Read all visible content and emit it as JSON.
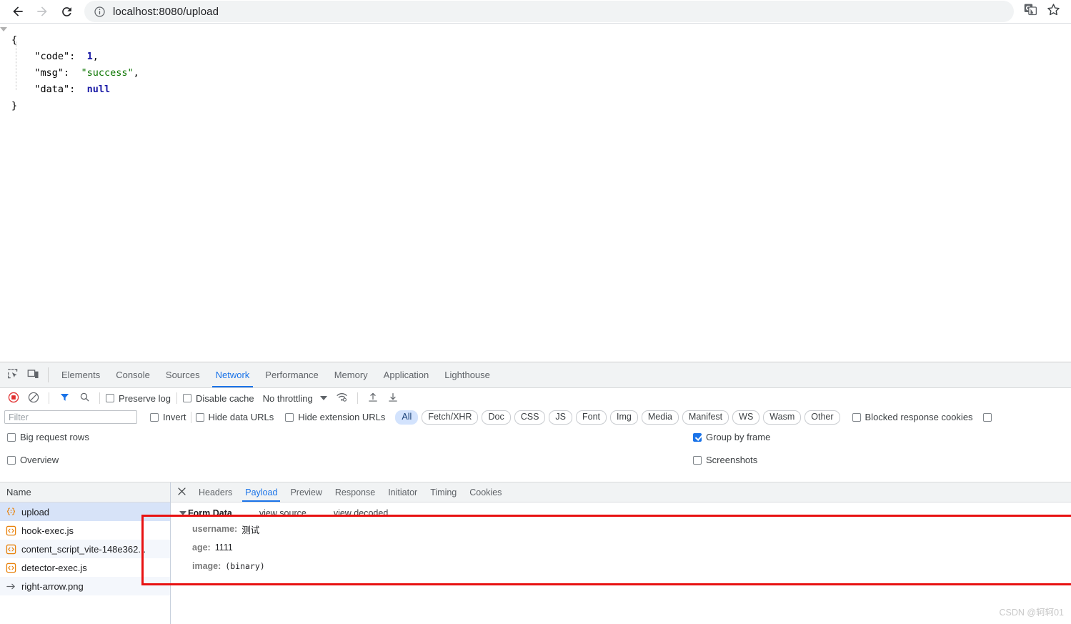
{
  "browser": {
    "back_icon": "arrow-left-icon",
    "forward_icon": "arrow-right-icon",
    "reload_icon": "reload-icon",
    "site_info_icon": "info-circle-icon",
    "url": "localhost:8080/upload",
    "translate_icon": "translate-icon",
    "bookmark_icon": "star-icon"
  },
  "page": {
    "json_response": {
      "open_brace": "{",
      "close_brace": "}",
      "entries": [
        {
          "key": "\"code\"",
          "colon": ":",
          "value": "1",
          "type": "number",
          "trail": ","
        },
        {
          "key": "\"msg\"",
          "colon": ":",
          "value": "\"success\"",
          "type": "string",
          "trail": ","
        },
        {
          "key": "\"data\"",
          "colon": ":",
          "value": "null",
          "type": "null",
          "trail": ""
        }
      ]
    }
  },
  "devtools": {
    "inspect_icon": "inspect-element-icon",
    "device_icon": "device-toolbar-icon",
    "tabs": [
      {
        "label": "Elements",
        "active": false
      },
      {
        "label": "Console",
        "active": false
      },
      {
        "label": "Sources",
        "active": false
      },
      {
        "label": "Network",
        "active": true
      },
      {
        "label": "Performance",
        "active": false
      },
      {
        "label": "Memory",
        "active": false
      },
      {
        "label": "Application",
        "active": false
      },
      {
        "label": "Lighthouse",
        "active": false
      }
    ],
    "network_controls": {
      "record_icon": "record-stop-icon",
      "clear_icon": "clear-icon",
      "filter_icon": "funnel-filter-icon",
      "search_icon": "search-icon",
      "preserve_log_label": "Preserve log",
      "preserve_log_checked": false,
      "disable_cache_label": "Disable cache",
      "disable_cache_checked": false,
      "throttling_label": "No throttling",
      "wifi_icon": "network-conditions-icon",
      "import_icon": "import-har-icon",
      "export_icon": "export-har-icon"
    },
    "filter_bar": {
      "filter_placeholder": "Filter",
      "filter_value": "",
      "invert_label": "Invert",
      "invert_checked": false,
      "hide_data_urls_label": "Hide data URLs",
      "hide_data_urls_checked": false,
      "hide_extension_urls_label": "Hide extension URLs",
      "hide_extension_urls_checked": false,
      "type_chips": [
        {
          "label": "All",
          "selected": true
        },
        {
          "label": "Fetch/XHR",
          "selected": false
        },
        {
          "label": "Doc",
          "selected": false
        },
        {
          "label": "CSS",
          "selected": false
        },
        {
          "label": "JS",
          "selected": false
        },
        {
          "label": "Font",
          "selected": false
        },
        {
          "label": "Img",
          "selected": false
        },
        {
          "label": "Media",
          "selected": false
        },
        {
          "label": "Manifest",
          "selected": false
        },
        {
          "label": "WS",
          "selected": false
        },
        {
          "label": "Wasm",
          "selected": false
        },
        {
          "label": "Other",
          "selected": false
        }
      ],
      "blocked_cookies_label": "Blocked response cookies",
      "blocked_cookies_checked": false,
      "extra_checkbox_checked": false
    },
    "options": {
      "big_request_rows_label": "Big request rows",
      "big_request_rows_checked": false,
      "overview_label": "Overview",
      "overview_checked": false,
      "group_by_frame_label": "Group by frame",
      "group_by_frame_checked": true,
      "screenshots_label": "Screenshots",
      "screenshots_checked": false
    },
    "request_list": {
      "column_header": "Name",
      "rows": [
        {
          "name": "upload",
          "icon": "json-file-icon",
          "selected": true
        },
        {
          "name": "hook-exec.js",
          "icon": "script-file-icon",
          "selected": false
        },
        {
          "name": "content_script_vite-148e362...",
          "icon": "script-file-icon",
          "selected": false
        },
        {
          "name": "detector-exec.js",
          "icon": "script-file-icon",
          "selected": false
        },
        {
          "name": "right-arrow.png",
          "icon": "redirect-arrow-icon",
          "selected": false
        }
      ]
    },
    "detail": {
      "close_icon": "close-icon",
      "tabs": [
        {
          "label": "Headers",
          "active": false
        },
        {
          "label": "Payload",
          "active": true
        },
        {
          "label": "Preview",
          "active": false
        },
        {
          "label": "Response",
          "active": false
        },
        {
          "label": "Initiator",
          "active": false
        },
        {
          "label": "Timing",
          "active": false
        },
        {
          "label": "Cookies",
          "active": false
        }
      ],
      "payload": {
        "section_title": "Form Data",
        "view_source_label": "view source",
        "view_decoded_label": "view decoded",
        "fields": [
          {
            "key": "username:",
            "value": "测试",
            "mono": false
          },
          {
            "key": "age:",
            "value": "1111",
            "mono": false
          },
          {
            "key": "image:",
            "value": "(binary)",
            "mono": true
          }
        ]
      }
    }
  },
  "annotation": {
    "rect_color": "#e81111"
  },
  "watermark": {
    "text": "CSDN @轲轲01"
  }
}
